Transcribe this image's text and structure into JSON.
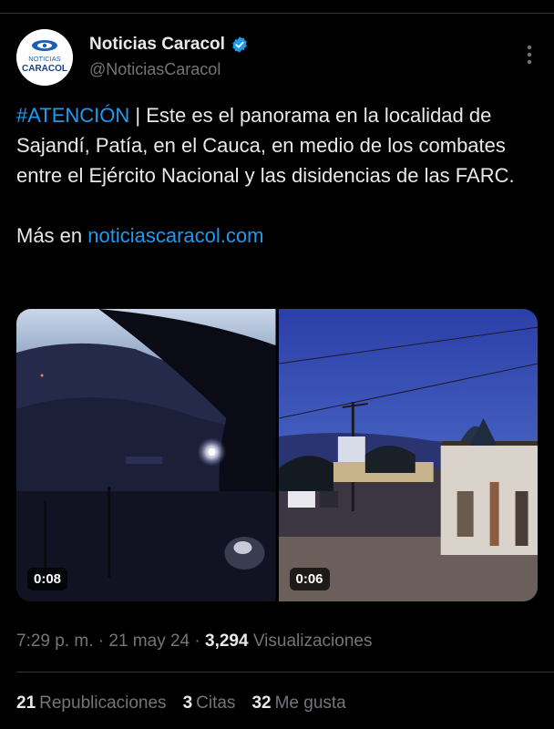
{
  "account": {
    "display_name": "Noticias Caracol",
    "handle": "@NoticiasCaracol",
    "logo_line1": "NOTICIAS",
    "logo_line2": "CARACOL"
  },
  "tweet": {
    "hashtag": "#ATENCIÓN",
    "body": " | Este es el panorama en la localidad de Sajandí, Patía, en el Cauca, en medio de los combates entre el Ejército Nacional y las disidencias de las FARC.",
    "more_prefix": "Más en ",
    "link": "noticiascaracol.com"
  },
  "media": [
    {
      "duration": "0:08"
    },
    {
      "duration": "0:06"
    }
  ],
  "meta": {
    "time": "7:29 p. m.",
    "date": "21 may 24",
    "views_count": "3,294",
    "views_label": "Visualizaciones"
  },
  "stats": {
    "reposts_count": "21",
    "reposts_label": "Republicaciones",
    "quotes_count": "3",
    "quotes_label": "Citas",
    "likes_count": "32",
    "likes_label": "Me gusta"
  },
  "colors": {
    "accent": "#1d9bf0",
    "text": "#e7e9ea",
    "secondary": "#71767b",
    "background": "#000000"
  },
  "icons": [
    "verified-badge-icon",
    "more-options-icon"
  ]
}
